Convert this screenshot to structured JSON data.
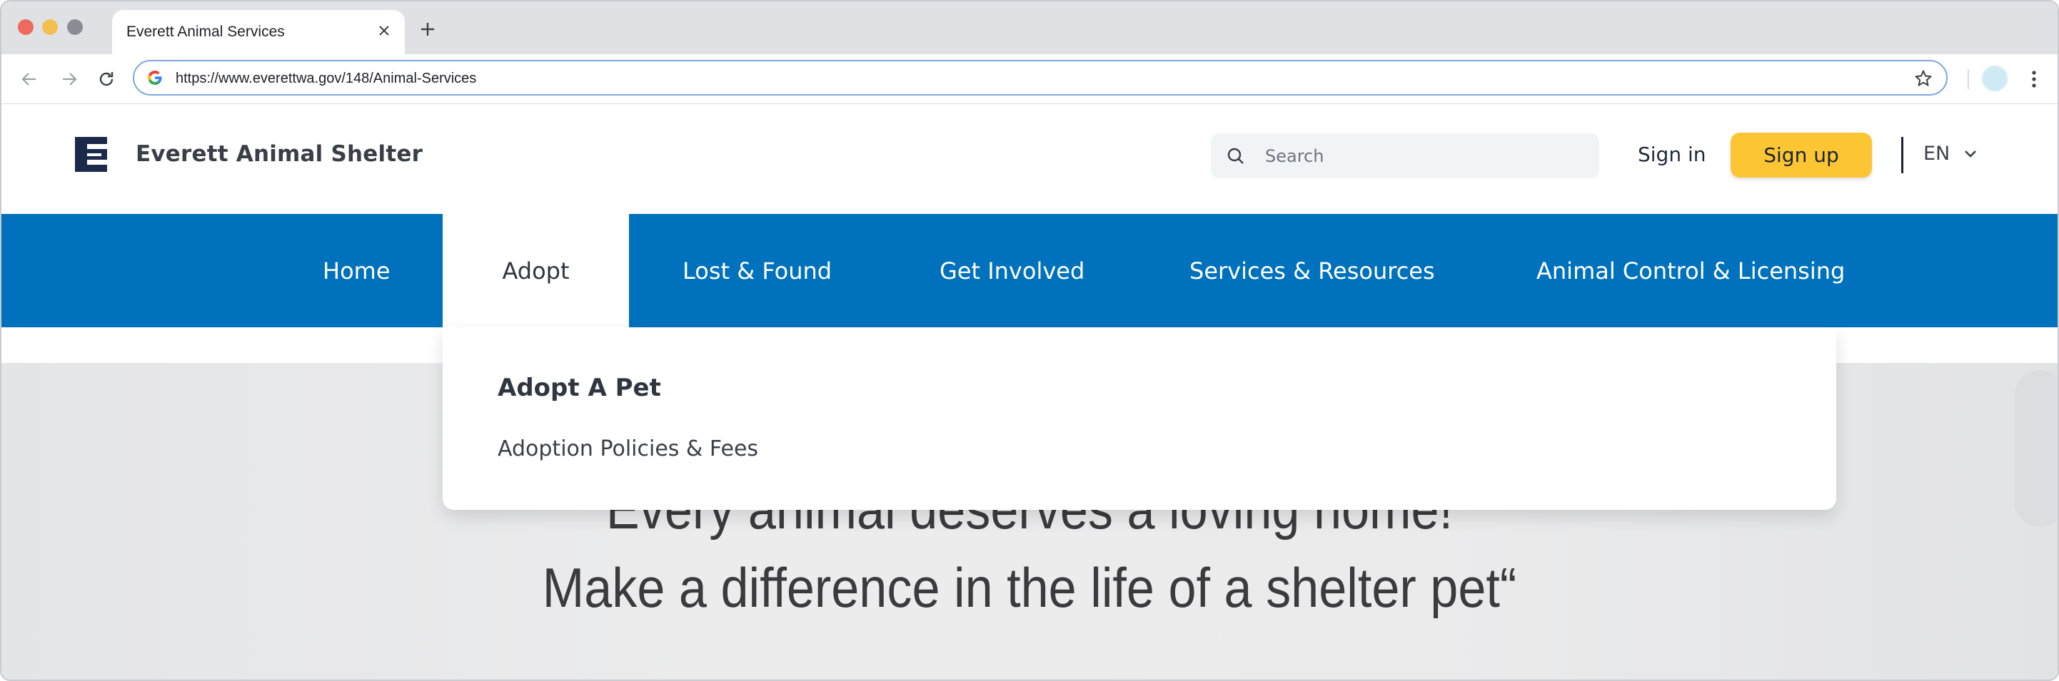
{
  "browser": {
    "tab_title": "Everett Animal Services",
    "url": "https://www.everettwa.gov/148/Animal-Services"
  },
  "header": {
    "site_name": "Everett Animal Shelter",
    "search_placeholder": "Search",
    "sign_in": "Sign in",
    "sign_up": "Sign up",
    "language": "EN"
  },
  "nav": {
    "items": [
      {
        "label": "Home"
      },
      {
        "label": "Adopt"
      },
      {
        "label": "Lost & Found"
      },
      {
        "label": "Get Involved"
      },
      {
        "label": "Services & Resources"
      },
      {
        "label": "Animal Control & Licensing"
      }
    ],
    "active": "Adopt"
  },
  "dropdown": {
    "items": [
      {
        "label": "Adopt A Pet"
      },
      {
        "label": "Adoption Policies & Fees"
      }
    ]
  },
  "hero": {
    "line1": "Every animal deserves a loving home!",
    "line2": "Make a difference in the life of a shelter pet“"
  },
  "colors": {
    "nav_blue": "#0071bc",
    "signup_yellow": "#fbc533",
    "logo_navy": "#1b2a4a"
  },
  "icons": {
    "logo": "shelter-logo-icon",
    "search": "search-icon",
    "language_chevron": "chevron-down-icon"
  }
}
